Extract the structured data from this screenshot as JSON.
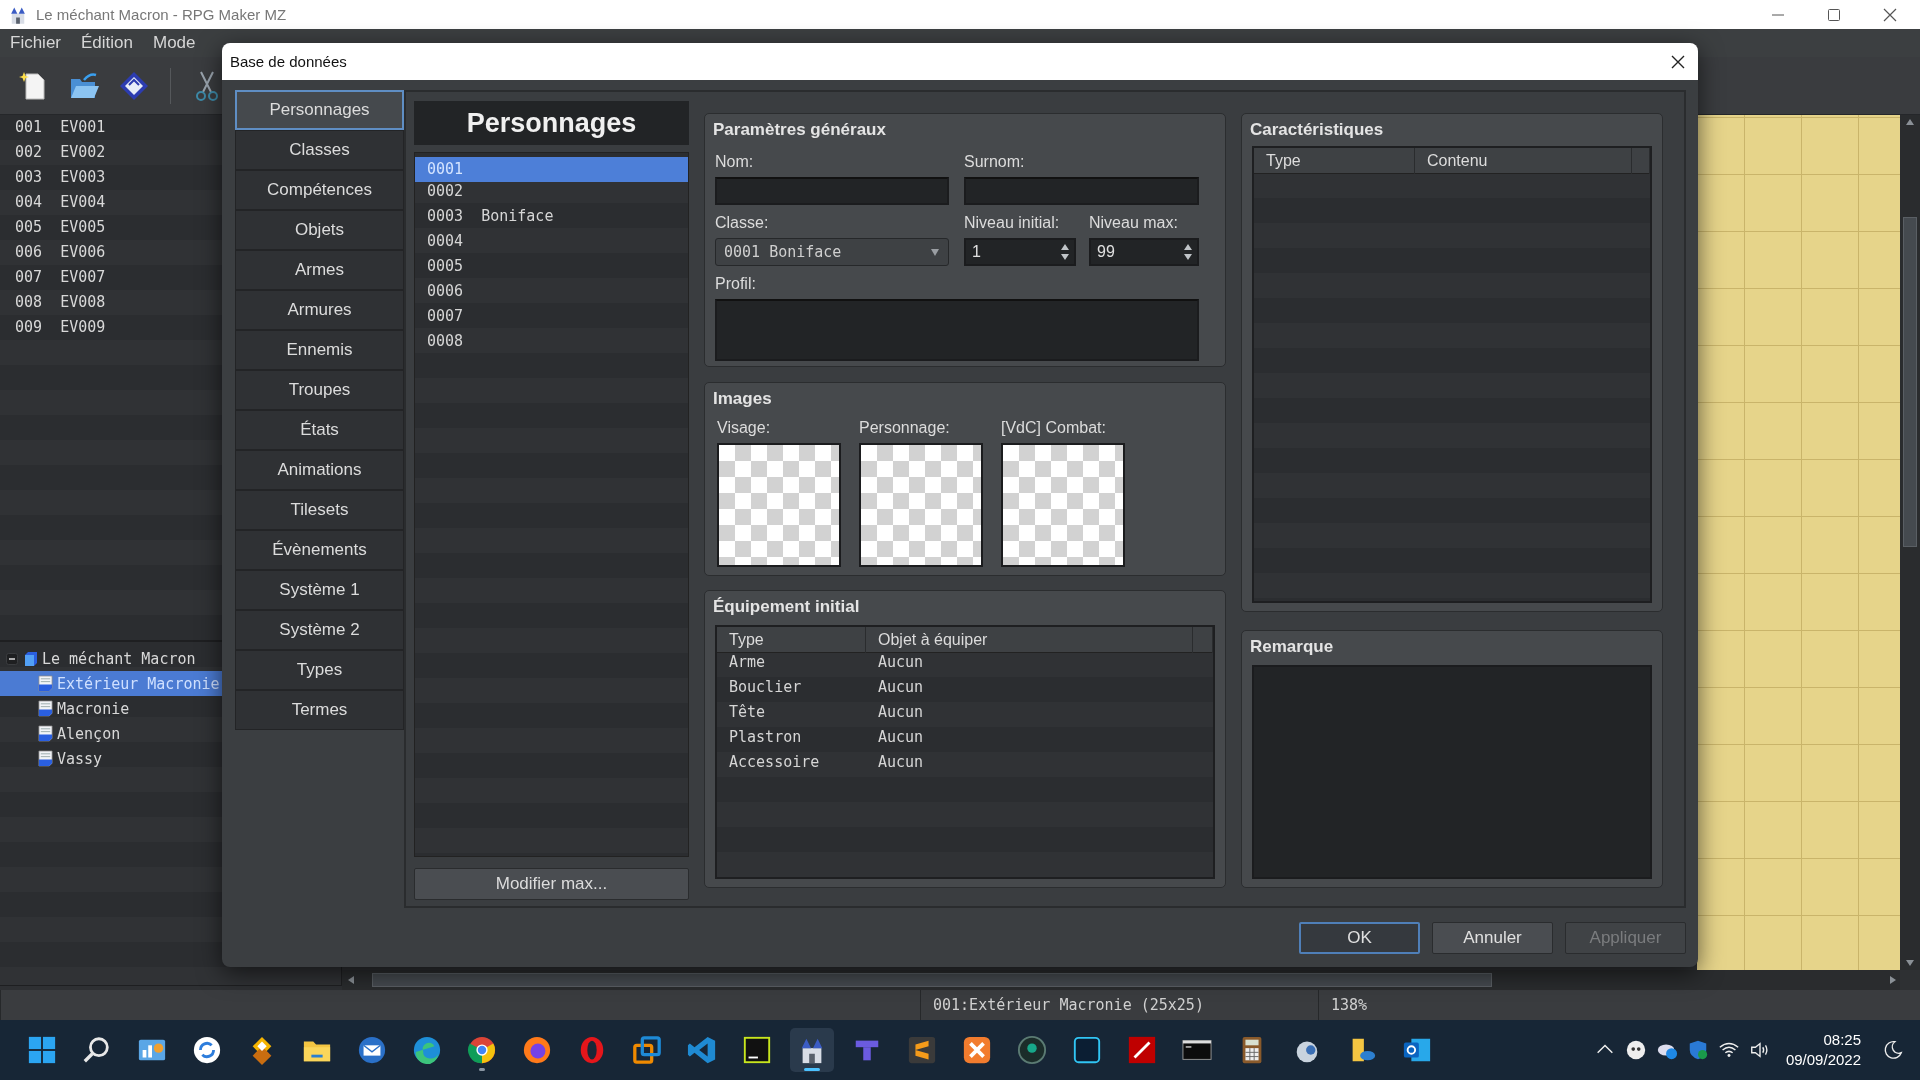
{
  "window": {
    "title": "Le méchant Macron - RPG Maker MZ"
  },
  "menu": [
    "Fichier",
    "Édition",
    "Mode"
  ],
  "toolbar": [
    {
      "kind": "new"
    },
    {
      "kind": "open"
    },
    {
      "kind": "save"
    },
    {
      "kind": "separator"
    },
    {
      "kind": "cut"
    }
  ],
  "events": [
    {
      "id": "001",
      "name": "EV001"
    },
    {
      "id": "002",
      "name": "EV002"
    },
    {
      "id": "003",
      "name": "EV003"
    },
    {
      "id": "004",
      "name": "EV004"
    },
    {
      "id": "005",
      "name": "EV005"
    },
    {
      "id": "006",
      "name": "EV006"
    },
    {
      "id": "007",
      "name": "EV007"
    },
    {
      "id": "008",
      "name": "EV008"
    },
    {
      "id": "009",
      "name": "EV009"
    }
  ],
  "map_tree": {
    "label": "Le méchant Macron",
    "expanded": true,
    "selected": false,
    "children": [
      {
        "label": "Extérieur Macronie",
        "selected": true
      },
      {
        "label": "Macronie",
        "selected": false
      },
      {
        "label": "Alençon",
        "selected": false
      },
      {
        "label": "Vassy",
        "selected": false
      }
    ]
  },
  "status_bar": {
    "map": "001:Extérieur Macronie (25x25)",
    "zoom": "138%"
  },
  "dialog": {
    "title": "Base de données",
    "categories": [
      {
        "label": "Personnages",
        "selected": true
      },
      {
        "label": "Classes",
        "selected": false
      },
      {
        "label": "Compétences",
        "selected": false
      },
      {
        "label": "Objets",
        "selected": false
      },
      {
        "label": "Armes",
        "selected": false
      },
      {
        "label": "Armures",
        "selected": false
      },
      {
        "label": "Ennemis",
        "selected": false
      },
      {
        "label": "Troupes",
        "selected": false
      },
      {
        "label": "États",
        "selected": false
      },
      {
        "label": "Animations",
        "selected": false
      },
      {
        "label": "Tilesets",
        "selected": false
      },
      {
        "label": "Évènements",
        "selected": false
      },
      {
        "label": "Système 1",
        "selected": false
      },
      {
        "label": "Système 2",
        "selected": false
      },
      {
        "label": "Types",
        "selected": false
      },
      {
        "label": "Termes",
        "selected": false
      }
    ],
    "list_title": "Personnages",
    "actors": [
      {
        "id": "0001",
        "selected": true
      },
      {
        "id": "0002",
        "selected": false
      },
      {
        "id": "0003",
        "name": "Boniface",
        "selected": false
      },
      {
        "id": "0004",
        "selected": false
      },
      {
        "id": "0005",
        "selected": false
      },
      {
        "id": "0006",
        "selected": false
      },
      {
        "id": "0007",
        "selected": false
      },
      {
        "id": "0008",
        "selected": false
      }
    ],
    "modify_max_button": "Modifier max...",
    "general": {
      "title": "Paramètres généraux",
      "name": {
        "label": "Nom:"
      },
      "nickname": {
        "label": "Surnom:"
      },
      "class": {
        "label": "Classe:",
        "value": "0001 Boniface"
      },
      "initial_level": {
        "label": "Niveau initial:",
        "value": "1"
      },
      "max_level": {
        "label": "Niveau max:",
        "value": "99"
      },
      "profile": {
        "label": "Profil:"
      }
    },
    "images": {
      "title": "Images",
      "slots": [
        "Visage:",
        "Personnage:",
        "[VdC] Combat:"
      ]
    },
    "equipment": {
      "title": "Équipement initial",
      "columns": [
        "Type",
        "Objet à équiper"
      ],
      "rows": [
        [
          "Arme",
          "Aucun"
        ],
        [
          "Bouclier",
          "Aucun"
        ],
        [
          "Tête",
          "Aucun"
        ],
        [
          "Plastron",
          "Aucun"
        ],
        [
          "Accessoire",
          "Aucun"
        ]
      ]
    },
    "traits": {
      "title": "Caractéristiques",
      "columns": [
        "Type",
        "Contenu"
      ]
    },
    "note": {
      "title": "Remarque"
    },
    "buttons": [
      {
        "label": "OK",
        "default": true,
        "disabled": false
      },
      {
        "label": "Annuler",
        "default": false,
        "disabled": false
      },
      {
        "label": "Appliquer",
        "default": false,
        "disabled": true
      }
    ]
  },
  "taskbar": {
    "apps": [
      {
        "kind": "start",
        "active": false,
        "running": false
      },
      {
        "kind": "search",
        "active": false,
        "running": false
      },
      {
        "kind": "chart",
        "active": false,
        "running": false
      },
      {
        "kind": "sync",
        "active": false,
        "running": false
      },
      {
        "kind": "diamond",
        "active": false,
        "running": false
      },
      {
        "kind": "folder",
        "active": false,
        "running": false
      },
      {
        "kind": "mail",
        "active": false,
        "running": false
      },
      {
        "kind": "edge",
        "active": false,
        "running": false
      },
      {
        "kind": "chrome",
        "active": false,
        "running": true
      },
      {
        "kind": "firefox",
        "active": false,
        "running": false
      },
      {
        "kind": "opera",
        "active": false,
        "running": false
      },
      {
        "kind": "vm",
        "active": false,
        "running": false
      },
      {
        "kind": "vscode",
        "active": false,
        "running": false
      },
      {
        "kind": "pycharm",
        "active": false,
        "running": false
      },
      {
        "kind": "castle",
        "active": true,
        "running": true
      },
      {
        "kind": "blocks",
        "active": false,
        "running": false
      },
      {
        "kind": "sublime",
        "active": false,
        "running": false
      },
      {
        "kind": "xampp",
        "active": false,
        "running": false
      },
      {
        "kind": "kraken",
        "active": false,
        "running": false
      },
      {
        "kind": "ps",
        "active": false,
        "running": false
      },
      {
        "kind": "filezilla",
        "active": false,
        "running": false
      },
      {
        "kind": "terminal",
        "active": false,
        "running": false
      },
      {
        "kind": "calculator",
        "active": false,
        "running": false
      },
      {
        "kind": "cloudapp",
        "active": false,
        "running": false
      },
      {
        "kind": "foldercloud",
        "active": false,
        "running": false
      },
      {
        "kind": "outlook",
        "active": false,
        "running": false
      }
    ],
    "tray": [
      {
        "kind": "chevron"
      },
      {
        "kind": "ghost"
      },
      {
        "kind": "cloud"
      },
      {
        "kind": "shield"
      },
      {
        "kind": "wifi"
      },
      {
        "kind": "volume"
      }
    ],
    "time": "08:25",
    "date": "09/09/2022"
  }
}
